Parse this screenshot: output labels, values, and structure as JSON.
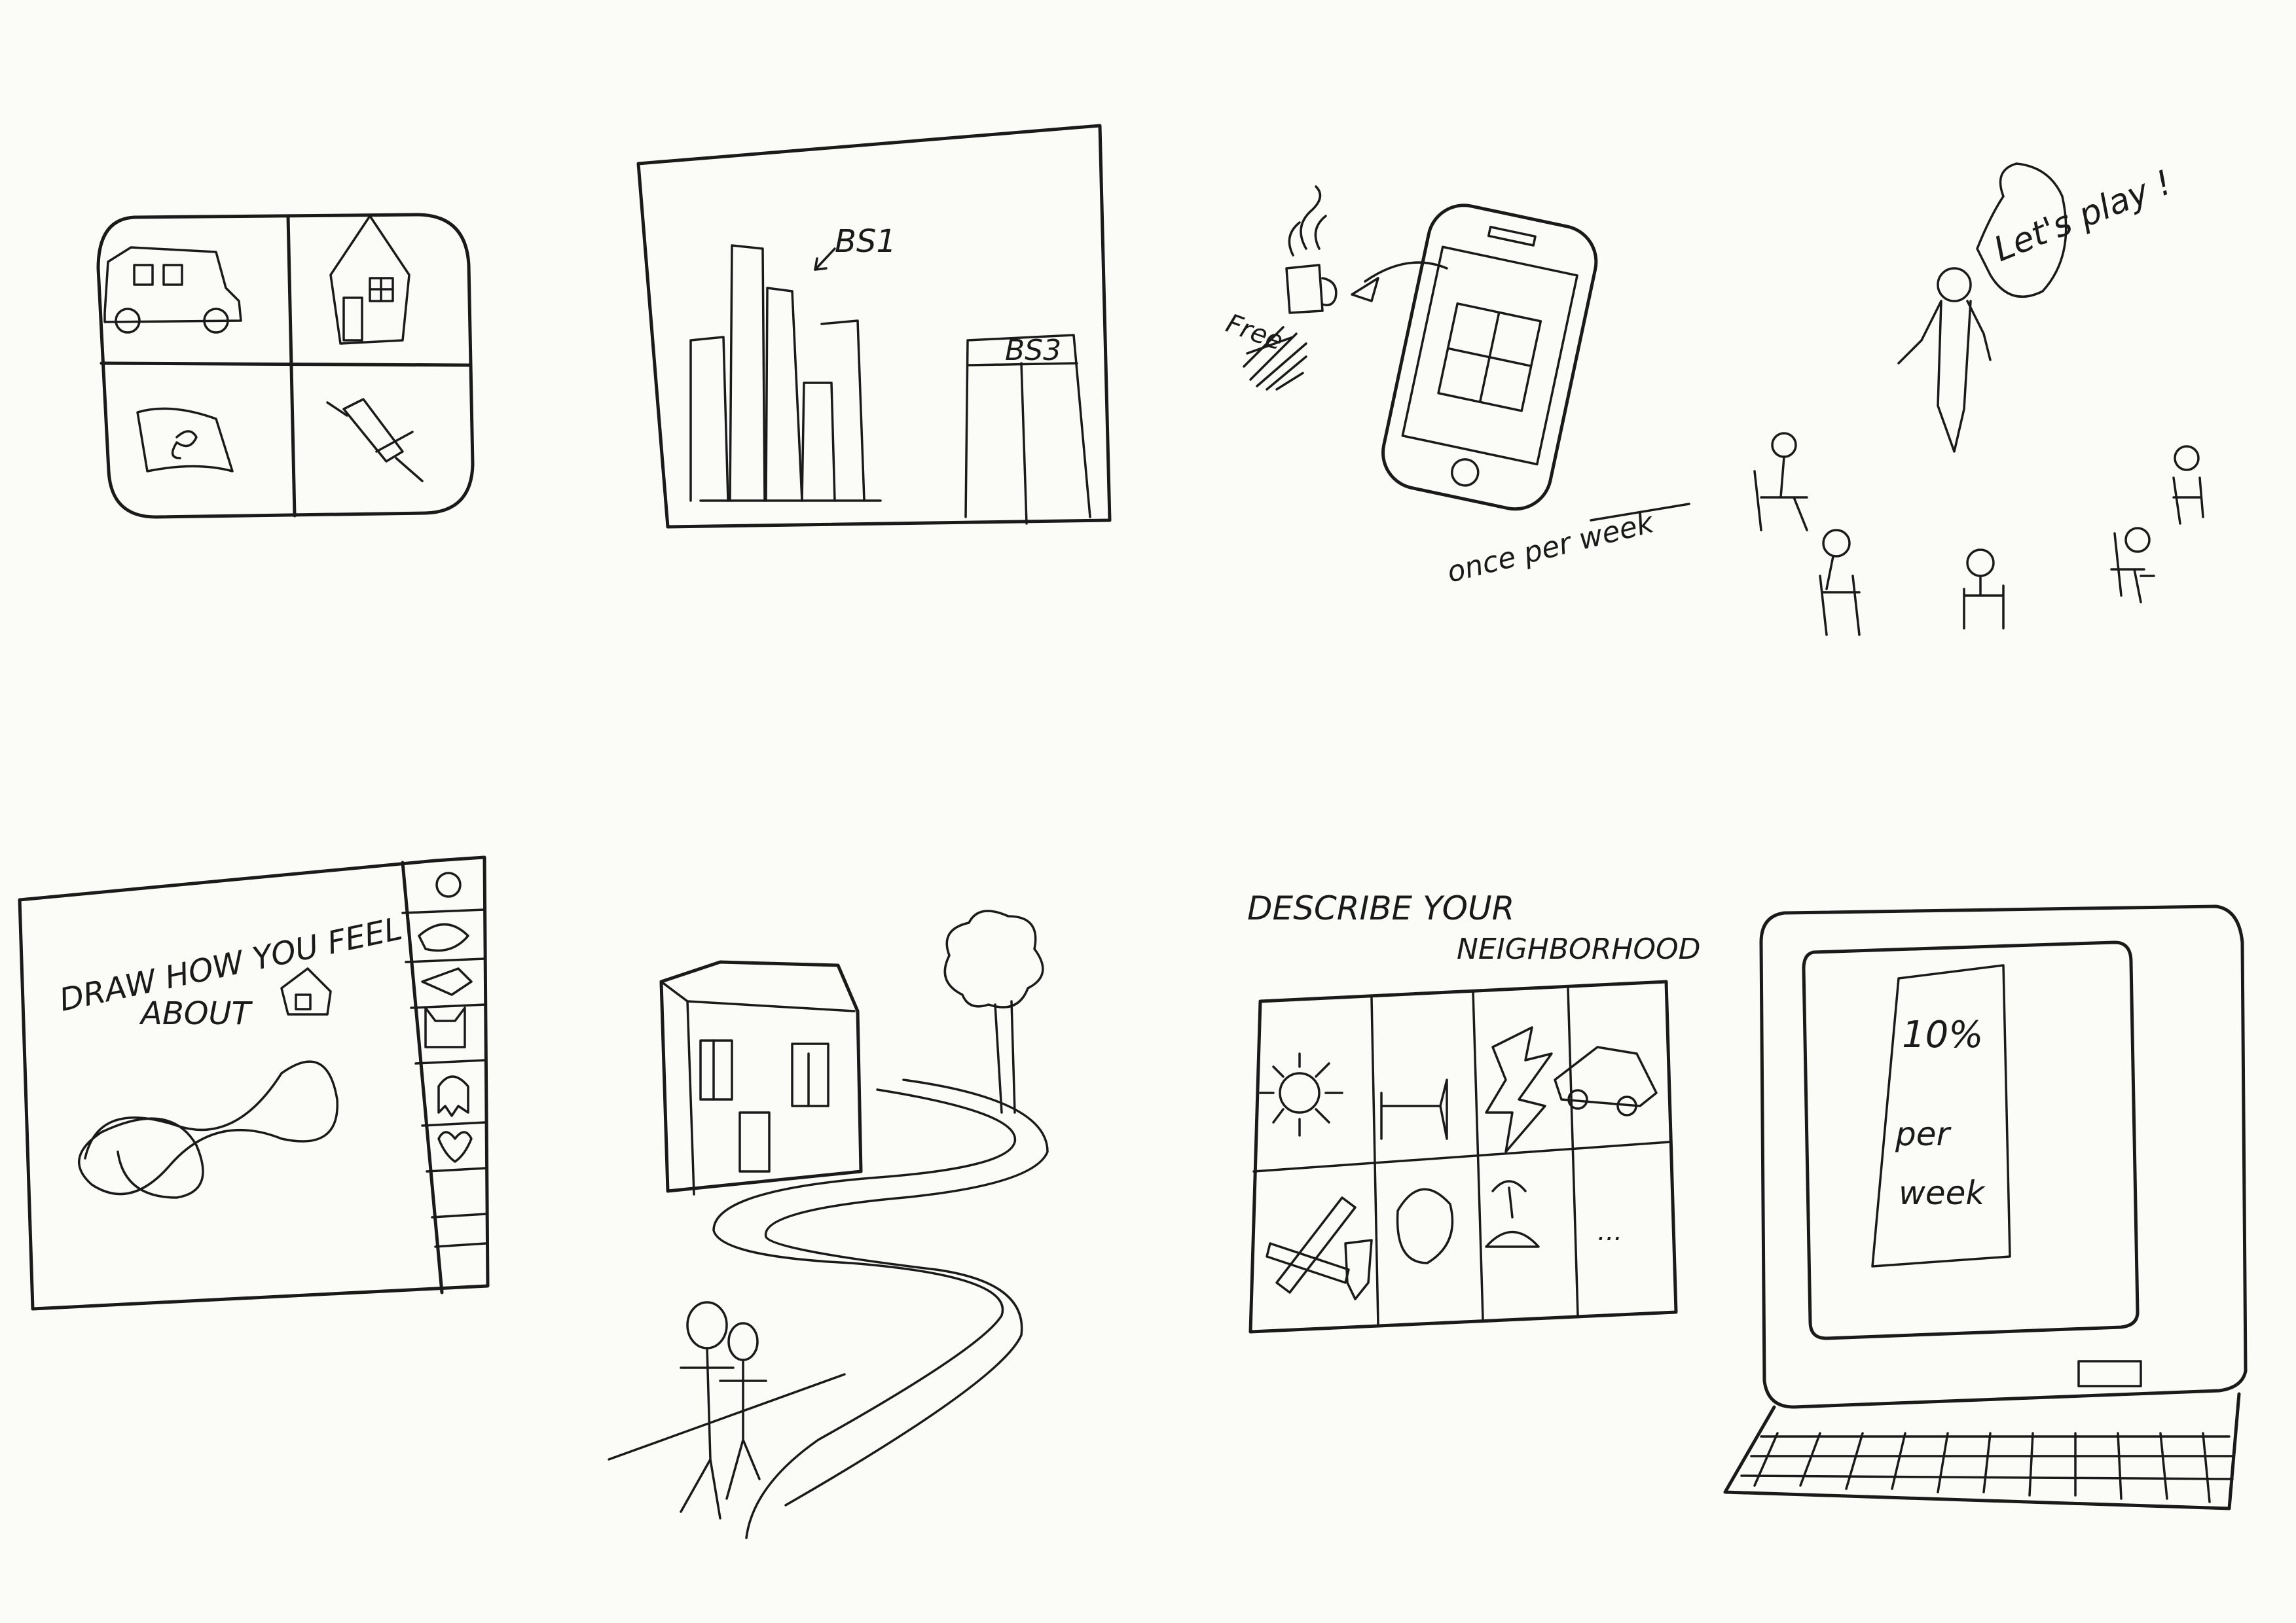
{
  "sketch1": {
    "title": ""
  },
  "sketch2": {
    "label_bs1": "BS1",
    "label_bs3": "BS3"
  },
  "sketch3": {
    "label_free": "Free",
    "label_frequency": "once per week",
    "speech": "Let's play !"
  },
  "sketch5": {
    "prompt_line1": "DRAW HOW YOU FEEL",
    "prompt_line2": "ABOUT"
  },
  "sketch7": {
    "prompt_line1": "DESCRIBE YOUR",
    "prompt_line2": "NEIGHBORHOOD",
    "more": "..."
  },
  "sketch8": {
    "value": "10%",
    "line2": "per",
    "line3": "week"
  },
  "colors": {
    "ink": "#1a1a1a",
    "paper": "#fbfbf8"
  }
}
